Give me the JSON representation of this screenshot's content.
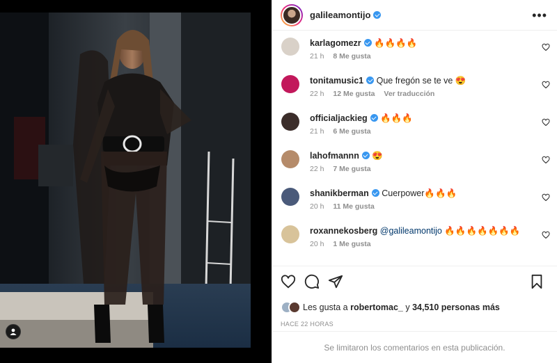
{
  "post": {
    "username": "galileamontijo",
    "verified": true,
    "more_icon": "more-horizontal-icon"
  },
  "comments": [
    {
      "username": "karlagomezr",
      "verified": true,
      "text": "🔥🔥🔥🔥",
      "time": "21 h",
      "likes": "8 Me gusta",
      "translate": "",
      "avatar_color": "#d9d1c8"
    },
    {
      "username": "tonitamusic1",
      "verified": true,
      "text": "Que fregón se te ve 😍",
      "time": "22 h",
      "likes": "12 Me gusta",
      "translate": "Ver traducción",
      "avatar_color": "#c2185b"
    },
    {
      "username": "officialjackieg",
      "verified": true,
      "text": "🔥🔥🔥",
      "time": "21 h",
      "likes": "6 Me gusta",
      "translate": "",
      "avatar_color": "#3b2d2a"
    },
    {
      "username": "lahofmannn",
      "verified": true,
      "text": "😍",
      "time": "22 h",
      "likes": "7 Me gusta",
      "translate": "",
      "avatar_color": "#b58b6a"
    },
    {
      "username": "shanikberman",
      "verified": true,
      "text": "Cuerpower🔥🔥🔥",
      "time": "20 h",
      "likes": "11 Me gusta",
      "translate": "",
      "avatar_color": "#4a5a7a"
    },
    {
      "username": "roxannekosberg",
      "verified": false,
      "mention": "@galileamontijo",
      "text": "🔥🔥🔥🔥🔥🔥🔥",
      "time": "20 h",
      "likes": "1 Me gusta",
      "translate": "",
      "avatar_color": "#d8c39a"
    }
  ],
  "likes": {
    "prefix": "Les gusta a",
    "user": "robertomac_",
    "connector": "y",
    "count": "34,510 personas más"
  },
  "time_ago": "HACE 22 HORAS",
  "comments_limited": "Se limitaron los comentarios en esta publicación."
}
